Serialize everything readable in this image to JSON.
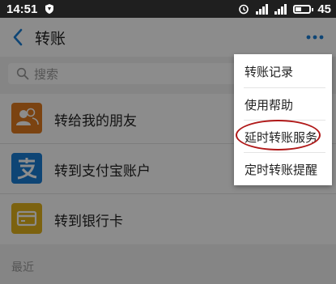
{
  "status_bar": {
    "time": "14:51",
    "battery": "45",
    "icons": [
      "shield-icon",
      "alarm-icon",
      "signal-icon",
      "battery-icon"
    ]
  },
  "header": {
    "title": "转账",
    "back_icon": "chevron-left-icon",
    "more_icon": "more-dots-icon",
    "accent_color": "#1a7fd6"
  },
  "search": {
    "placeholder": "搜索"
  },
  "list": {
    "items": [
      {
        "label": "转给我的朋友",
        "icon": "contacts-icon",
        "color": "#e07a1f"
      },
      {
        "label": "转到支付宝账户",
        "icon": "alipay-icon",
        "color": "#1a7fd6"
      },
      {
        "label": "转到银行卡",
        "icon": "bank-card-icon",
        "color": "#e2b21c"
      }
    ]
  },
  "section": {
    "recent_label": "最近"
  },
  "menu": {
    "items": [
      {
        "label": "转账记录"
      },
      {
        "label": "使用帮助"
      },
      {
        "label": "延时转账服务",
        "highlighted": true
      },
      {
        "label": "定时转账提醒"
      }
    ],
    "highlight_color": "#b01818"
  }
}
